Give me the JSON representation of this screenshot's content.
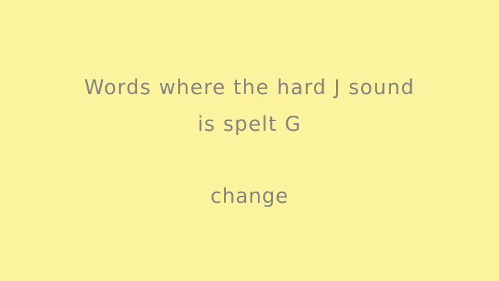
{
  "slide": {
    "title_line1": "Words where the hard J sound",
    "title_line2": "is spelt G",
    "word": "change"
  },
  "colors": {
    "background": "#FBF39E",
    "text": "#86847E"
  }
}
